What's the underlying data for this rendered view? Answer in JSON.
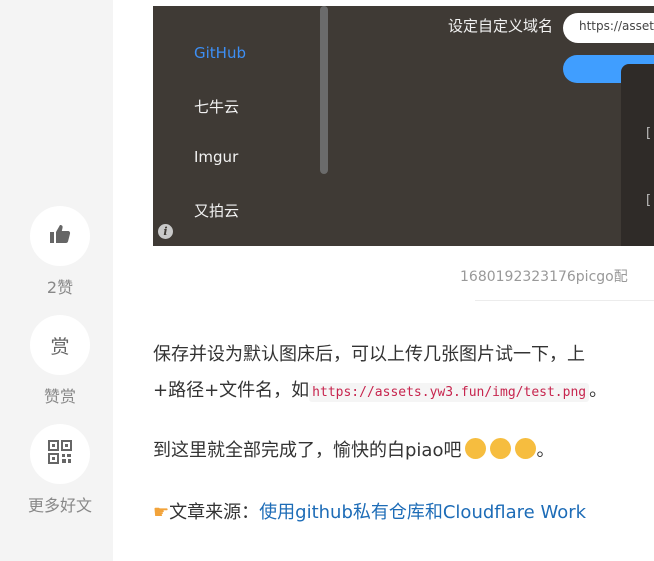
{
  "sidebar": {
    "like_count": "2赞",
    "reward_icon": "赏",
    "reward_label": "赞赏",
    "more_label": "更多好文"
  },
  "screenshot": {
    "menu_items": [
      "GitHub",
      "七牛云",
      "Imgur",
      "又拍云"
    ],
    "domain_label": "设定自定义域名",
    "domain_value": "https://assets",
    "dialog_marks": [
      "[",
      "[",
      "["
    ]
  },
  "article": {
    "caption": "1680192323176picgo配",
    "para1_line1": "保存并设为默认图床后，可以上传几张图片试一下，上",
    "para1_prefix": "+路径+文件名，如",
    "para1_code": "https://assets.yw3.fun/img/test.png",
    "para1_suffix": "。",
    "para2_text": "到这里就全部完成了，愉快的白piao吧",
    "para2_end": "。",
    "source_label": "文章来源：",
    "source_link": "使用github私有仓库和Cloudflare Work"
  },
  "icons": {
    "like": "thumbs-up-icon",
    "reward": "reward-icon",
    "more": "qr-code-icon",
    "info": "info-icon",
    "pointer": "pointing-hand-icon",
    "emoji": "party-face-emoji"
  },
  "colors": {
    "link": "#1d6cb7",
    "active_menu": "#3d8ff5",
    "button": "#409eff",
    "code": "#c7254e"
  }
}
